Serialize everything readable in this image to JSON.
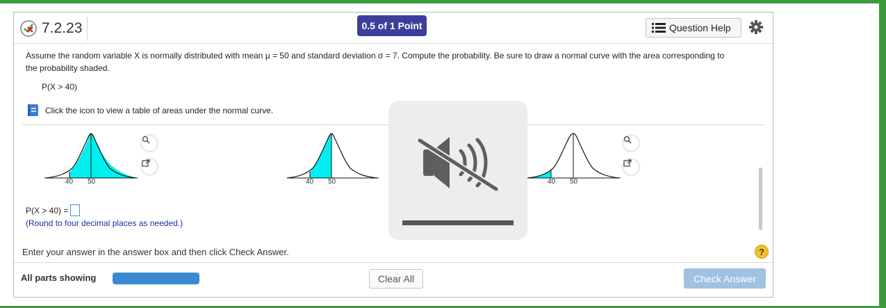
{
  "header": {
    "question_id": "7.2.23",
    "points": "0.5 of 1 Point",
    "help_label": "Question Help",
    "status_icon": "partial-credit-icon",
    "settings_icon": "gear-icon"
  },
  "question": {
    "prompt": "Assume the random variable X is normally distributed with mean μ = 50 and standard deviation σ = 7. Compute the probability. Be sure to draw a normal curve with the area corresponding to the probability shaded.",
    "expression": "P(X > 40)",
    "table_link_text": "Click the icon to view a table of areas under the normal curve."
  },
  "choices": [
    {
      "tick1": "40",
      "tick2": "50",
      "shaded": "right of 40"
    },
    {
      "tick1": "40",
      "tick2": "50",
      "shaded": "between 40 and 50"
    },
    {
      "tick1": "40",
      "tick2": "50",
      "shaded": "left of 40"
    }
  ],
  "answer": {
    "label": "P(X > 40) =",
    "value": "",
    "note": "(Round to four decimal places as needed.)"
  },
  "instruction": "Enter your answer in the answer box and then click Check Answer.",
  "footer": {
    "parts_label": "All parts showing",
    "clear_label": "Clear All",
    "check_label": "Check Answer"
  },
  "overlay": {
    "icon": "muted-speaker-icon",
    "volume_level": 0
  },
  "colors": {
    "frame": "#3a9b3a",
    "badge": "#3d3e9c",
    "shade": "#00f0f0",
    "progress": "#3a8ad0",
    "check_button": "#9fc2e3",
    "note_text": "#1a2ea8"
  }
}
